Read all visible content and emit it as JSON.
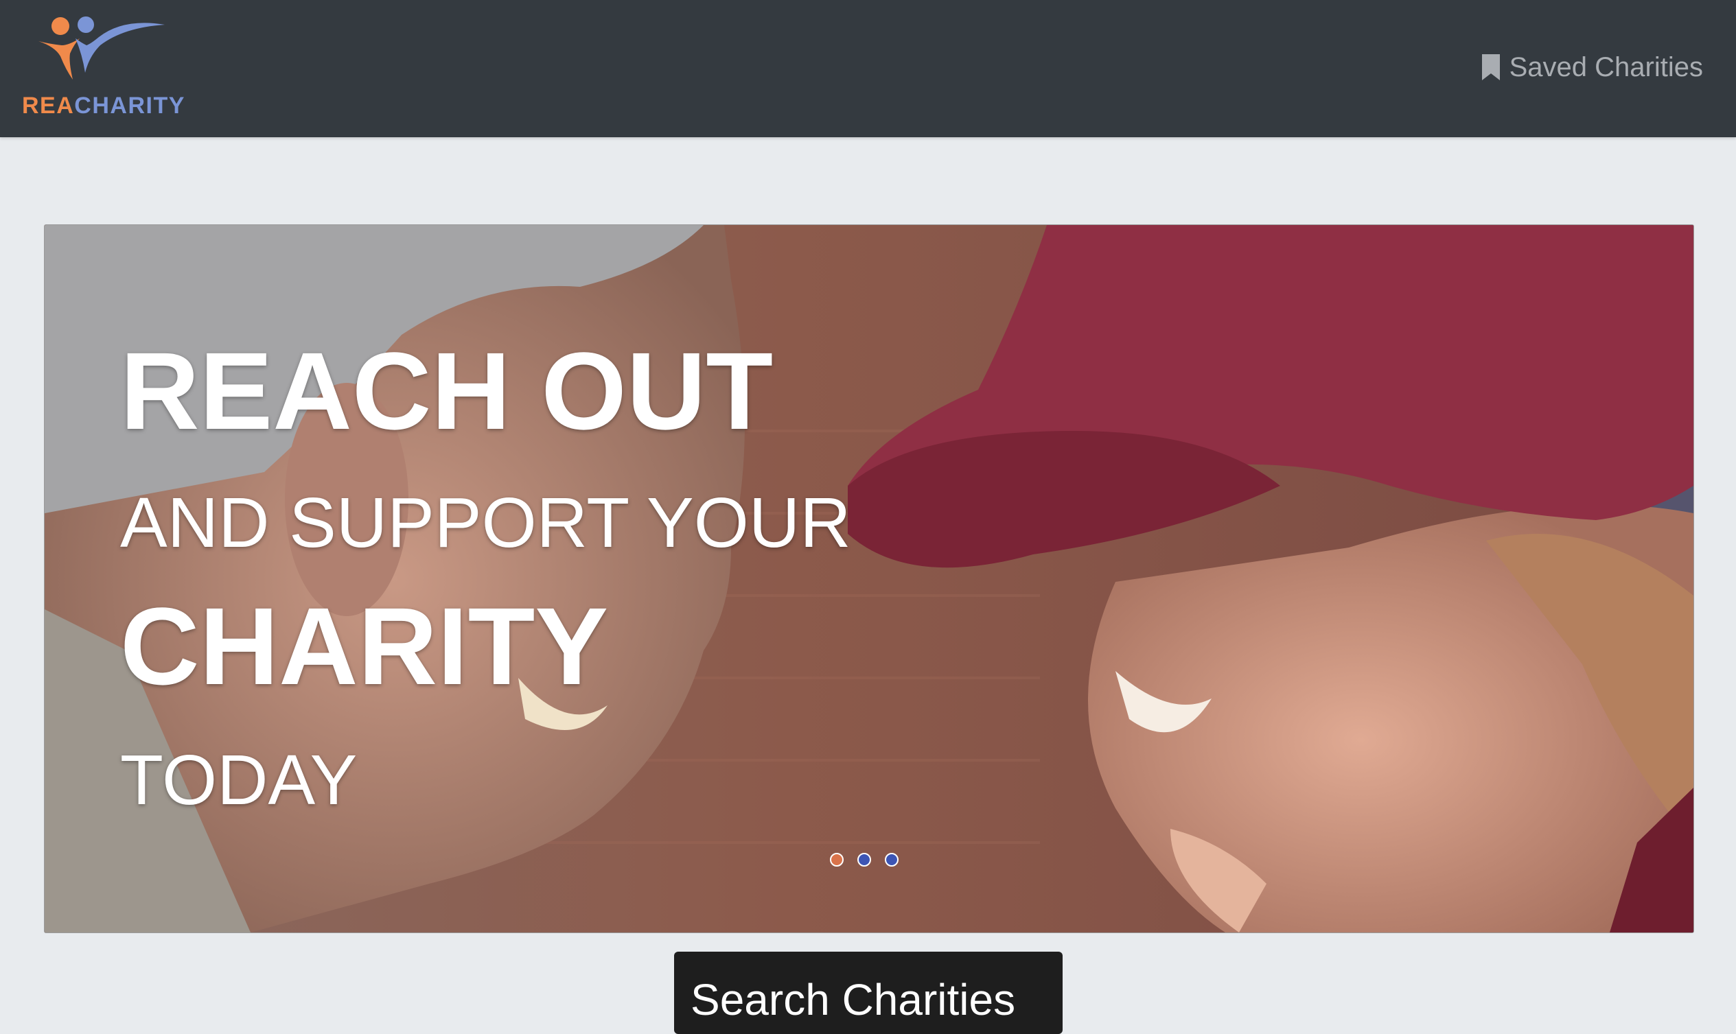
{
  "navbar": {
    "brand": {
      "part1": "REA",
      "part2": "CHARITY",
      "icon": "people-logo-icon"
    },
    "saved_link": {
      "label": "Saved Charities",
      "icon": "bookmark-icon"
    }
  },
  "hero": {
    "line1": "REACH OUT",
    "line2": "AND SUPPORT YOUR",
    "line3": "CHARITY",
    "line4": "TODAY",
    "slides": 3,
    "active_slide": 1
  },
  "search_button": {
    "label": "Search Charities"
  },
  "colors": {
    "navbar": "#343a40",
    "page_bg": "#e8ebee",
    "brand_orange": "#f08a4b",
    "brand_blue": "#7b95d6",
    "indicator_active": "#d9734a",
    "indicator_inactive": "#3c55b4"
  }
}
